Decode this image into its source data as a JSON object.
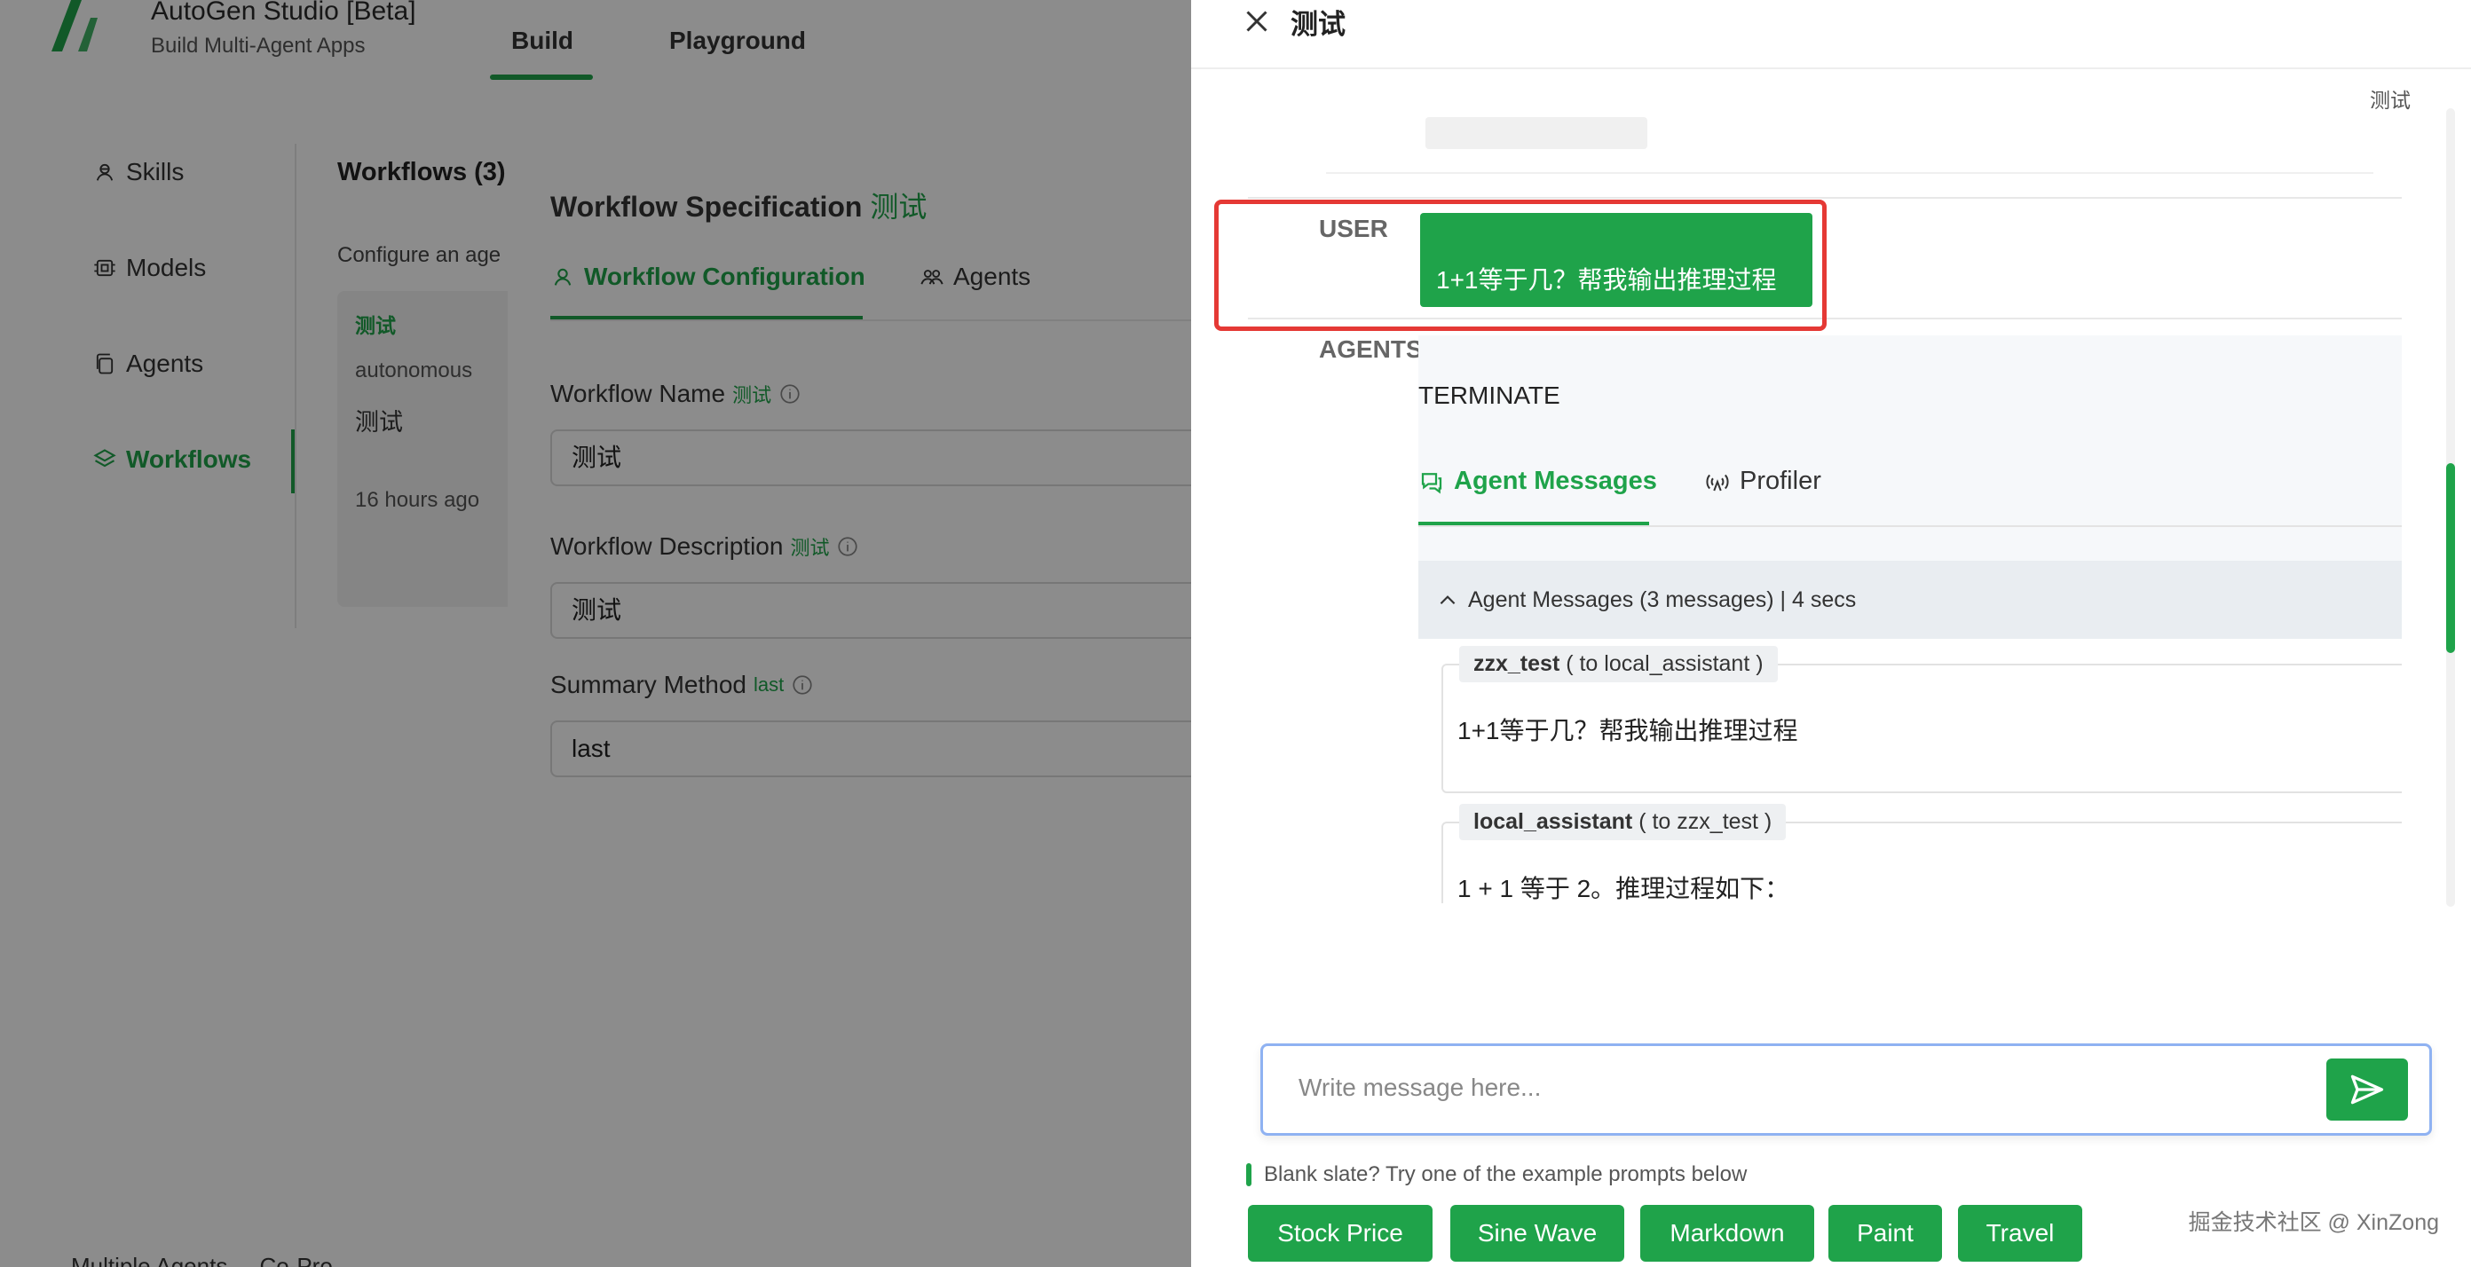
{
  "app": {
    "title": "AutoGen Studio [Beta]",
    "subtitle": "Build Multi-Agent Apps",
    "tabs": [
      {
        "label": "Build"
      },
      {
        "label": "Playground"
      }
    ]
  },
  "sidebar": {
    "items": [
      {
        "label": "Skills"
      },
      {
        "label": "Models"
      },
      {
        "label": "Agents"
      },
      {
        "label": "Workflows"
      }
    ]
  },
  "workflows": {
    "heading": "Workflows (3)",
    "description": "Configure an age",
    "card": {
      "title": "测试",
      "type": "autonomous",
      "name": "测试",
      "time": "16 hours ago"
    },
    "bottom_text": "Multiple Agents ... Co-Pro"
  },
  "modal": {
    "title": "Workflow Specification",
    "title_tag": "测试",
    "tabs": [
      {
        "label": "Workflow Configuration"
      },
      {
        "label": "Agents"
      }
    ],
    "fields": [
      {
        "label": "Workflow Name",
        "tag": "测试",
        "value": "测试"
      },
      {
        "label": "Workflow Description",
        "tag": "测试",
        "value": "测试"
      },
      {
        "label": "Summary Method",
        "tag": "last",
        "value": "last"
      }
    ]
  },
  "drawer": {
    "title": "测试",
    "tag": "测试",
    "user_role": "USER",
    "user_message": "1+1等于几？帮我输出推理过程",
    "agents_role": "AGENTS",
    "agent_reply": "TERMINATE",
    "tabs": [
      {
        "label": "Agent Messages"
      },
      {
        "label": "Profiler"
      }
    ],
    "messages_summary": "Agent Messages (3 messages) | 4 secs",
    "messages": [
      {
        "sender": "zzx_test",
        "recipient": "( to local_assistant )",
        "body": "1+1等于几？帮我输出推理过程"
      },
      {
        "sender": "local_assistant",
        "recipient": "( to zzx_test )",
        "body": "1 + 1 等于 2。推理过程如下："
      }
    ],
    "composer": {
      "placeholder": "Write message here...",
      "value": ""
    },
    "hint": "Blank slate? Try one of the example prompts below",
    "example_prompts": [
      {
        "label": "Stock Price"
      },
      {
        "label": "Sine Wave"
      },
      {
        "label": "Markdown"
      },
      {
        "label": "Paint"
      },
      {
        "label": "Travel"
      }
    ],
    "watermark": "掘金技术社区 @ XinZong"
  },
  "colors": {
    "accent": "#1fa34a",
    "highlight": "#e53935",
    "composer_border": "#8fb2f2"
  },
  "icons": [
    "logo-icon",
    "skills-icon",
    "models-icon",
    "agents-icon",
    "workflows-icon",
    "info-icon",
    "close-icon",
    "chat-icon",
    "signal-icon",
    "chevron-up-icon",
    "send-icon"
  ]
}
